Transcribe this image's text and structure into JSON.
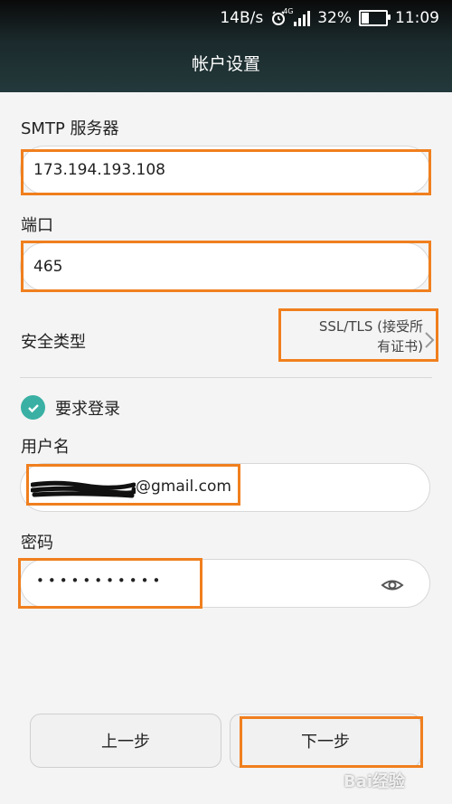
{
  "status": {
    "speed": "14B/s",
    "net": "4G",
    "battery": "32%",
    "time": "11:09"
  },
  "header": {
    "title": "帐户设置"
  },
  "form": {
    "smtp_label": "SMTP 服务器",
    "smtp_value": "173.194.193.108",
    "port_label": "端口",
    "port_value": "465",
    "security_label": "安全类型",
    "security_value_line1": "SSL/TLS (接受所",
    "security_value_line2": "有证书)",
    "require_login_label": "要求登录",
    "require_login_checked": true,
    "username_label": "用户名",
    "username_suffix": "@gmail.com",
    "password_label": "密码",
    "password_mask": "•••••••••••"
  },
  "buttons": {
    "prev": "上一步",
    "next": "下一步"
  },
  "watermark": "Bai经验",
  "colors": {
    "accent": "#39b0a3",
    "highlight": "#f07f1e"
  }
}
